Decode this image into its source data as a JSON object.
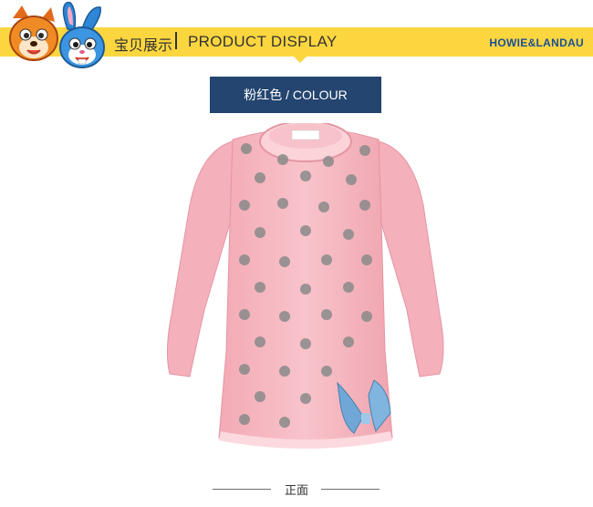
{
  "header": {
    "title_cn": "宝贝展示",
    "title_en": "PRODUCT DISPLAY",
    "brand": "HOWIE&LANDAU",
    "banner_color": "#fcd63f"
  },
  "colour_tag": {
    "label": "粉红色 / COLOUR",
    "bg_color": "#24456f"
  },
  "product": {
    "garment_color": "#f6b8c0",
    "bow_color": "#6fa8d6"
  },
  "footer": {
    "label": "正面"
  }
}
